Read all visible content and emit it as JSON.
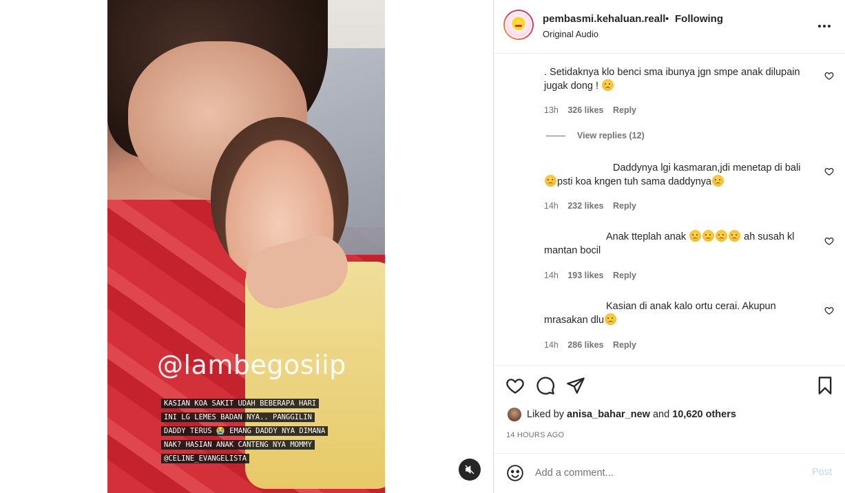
{
  "header": {
    "username": "pembasmi.kehaluan.reall",
    "separator": "•",
    "follow_status": "Following",
    "audio": "Original Audio",
    "more_icon": "more-horizontal-icon"
  },
  "video": {
    "watermark": "@lambegosiip",
    "caption": "Kasian koa sakit udah beberapa hari ini lg lemes badan nya.. panggilin daddy terus 😭 emang daddy nya dimana nak? hasian anak canteng nya mommy @celine_evangelista",
    "mute_icon": "speaker-muted-icon"
  },
  "comments": [
    {
      "text": ". Setidaknya klo benci sma ibunya jgn smpe anak dilupain jugak dong ! ",
      "emoji_after": 1,
      "time": "13h",
      "likes": "326 likes",
      "reply": "Reply"
    },
    {
      "text": "Daddynya lgi kasmaran,jdi menetap di bali ",
      "text2": "psti koa kngen tuh sama daddynya",
      "time": "14h",
      "likes": "232 likes",
      "reply": "Reply"
    },
    {
      "text": "Anak tteplah anak ",
      "text2": " ah susah kl mantan bocil",
      "time": "14h",
      "likes": "193 likes",
      "reply": "Reply"
    },
    {
      "text": "Kasian di anak kalo ortu cerai. Akupun mrasakan dlu",
      "time": "14h",
      "likes": "286 likes",
      "reply": "Reply"
    }
  ],
  "view_replies": "View replies (12)",
  "actions": {
    "like_icon": "heart-icon",
    "comment_icon": "comment-icon",
    "share_icon": "send-icon",
    "save_icon": "bookmark-icon"
  },
  "liked_by": {
    "prefix": "Liked by",
    "user": "anisa_bahar_new",
    "and": "and",
    "others": "10,620 others"
  },
  "timestamp": "14 HOURS AGO",
  "add_comment": {
    "placeholder": "Add a comment...",
    "post_label": "Post"
  }
}
